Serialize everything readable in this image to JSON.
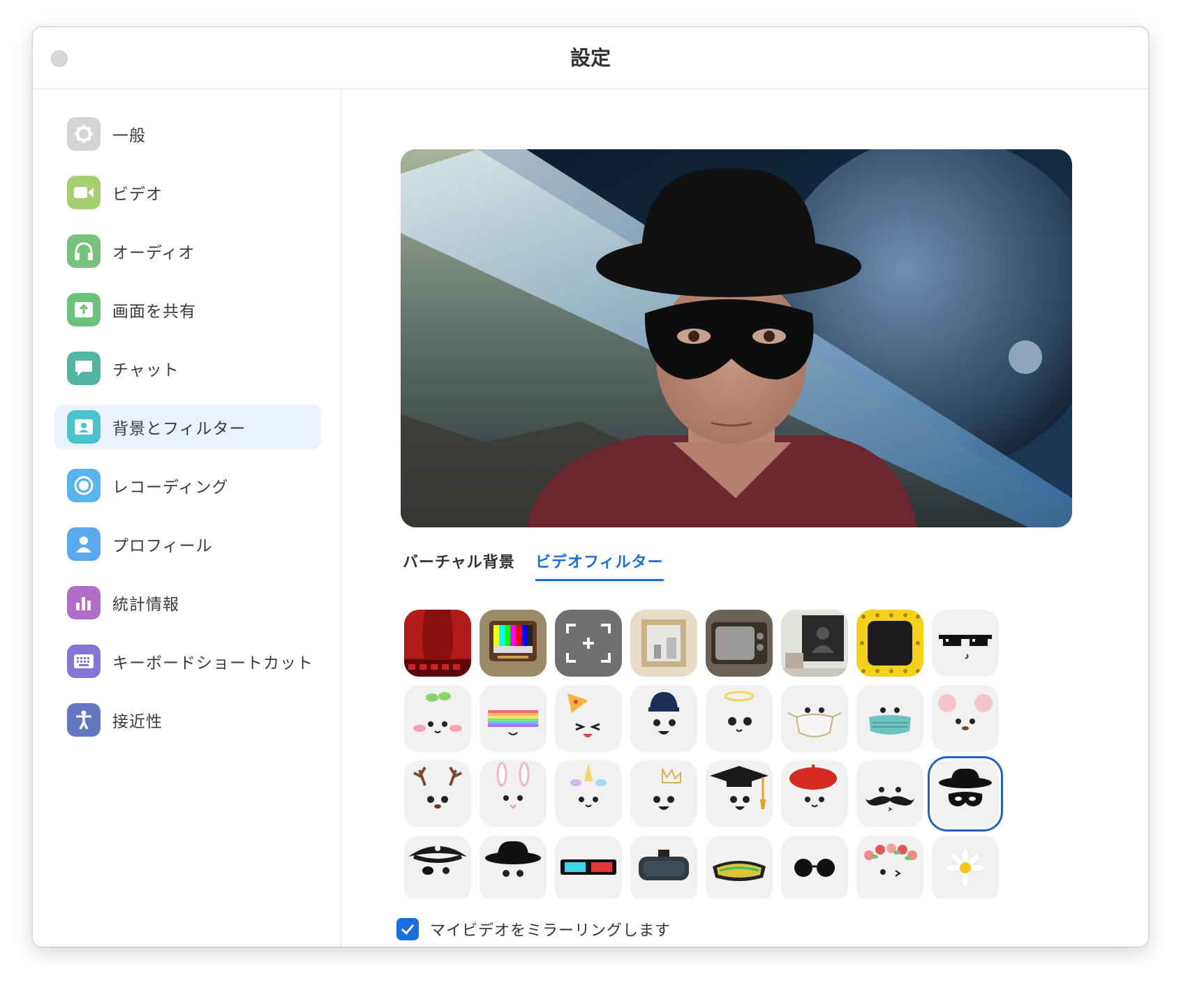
{
  "window": {
    "title": "設定"
  },
  "sidebar": {
    "items": [
      {
        "label": "一般",
        "icon": "gear-icon",
        "color": "#d4d4d4"
      },
      {
        "label": "ビデオ",
        "icon": "video-camera-icon",
        "color": "#a6cf6f"
      },
      {
        "label": "オーディオ",
        "icon": "headphones-icon",
        "color": "#77c27a"
      },
      {
        "label": "画面を共有",
        "icon": "share-screen-icon",
        "color": "#6cc27a"
      },
      {
        "label": "チャット",
        "icon": "chat-bubble-icon",
        "color": "#54b4a2"
      },
      {
        "label": "背景とフィルター",
        "icon": "background-person-icon",
        "color": "#48c4cf",
        "active": true
      },
      {
        "label": "レコーディング",
        "icon": "record-icon",
        "color": "#56b5ec"
      },
      {
        "label": "プロフィール",
        "icon": "profile-icon",
        "color": "#5ba8ee"
      },
      {
        "label": "統計情報",
        "icon": "statistics-icon",
        "color": "#b16ec7"
      },
      {
        "label": "キーボードショートカット",
        "icon": "keyboard-icon",
        "color": "#8277d6"
      },
      {
        "label": "接近性",
        "icon": "accessibility-icon",
        "color": "#6476c2"
      }
    ]
  },
  "tabs": {
    "virtual_background": "バーチャル背景",
    "video_filter": "ビデオフィルター",
    "active": "video_filter"
  },
  "filters": [
    "theater-curtain-filter",
    "retro-tv-color-bars-filter",
    "camera-viewfinder-filter",
    "picture-frame-filter",
    "old-tv-filter",
    "gallery-portrait-filter",
    "emoji-border-filter",
    "pixel-sunglasses-filter",
    "sprout-face-filter",
    "rainbow-face-filter",
    "pizza-party-hat-filter",
    "zoom-cap-filter",
    "halo-filter",
    "white-mask-filter",
    "surgical-mask-filter",
    "mouse-ears-filter",
    "reindeer-antlers-filter",
    "bunny-ears-filter",
    "unicorn-horn-filter",
    "crown-filter",
    "graduation-cap-filter",
    "beret-filter",
    "mustache-filter",
    "bandit-hat-mask-filter",
    "pirate-hat-filter",
    "black-hat-filter",
    "3d-glasses-filter",
    "vr-headset-filter",
    "ski-goggles-filter",
    "round-sunglasses-filter",
    "flower-crown-filter",
    "daisy-filter"
  ],
  "selected_filter": "bandit-hat-mask-filter",
  "mirror": {
    "label": "マイビデオをミラーリングします",
    "checked": true
  },
  "colors": {
    "accent": "#1a6fe0",
    "active_nav_bg": "#e9f2fd"
  }
}
